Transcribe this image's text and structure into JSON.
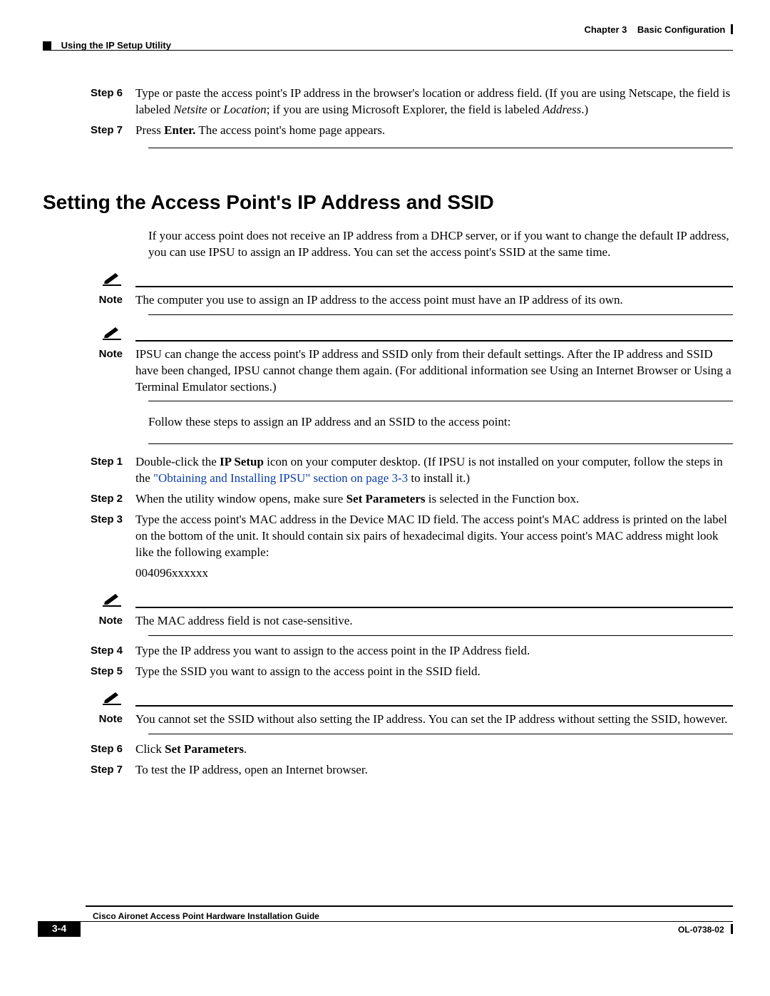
{
  "header": {
    "chapter_label": "Chapter 3",
    "chapter_title": "Basic Configuration",
    "section_title": "Using the IP Setup Utility"
  },
  "top_steps": {
    "s6": {
      "label": "Step 6",
      "t1": "Type or paste the access point's IP address in the browser's location or address field. (If you are using Netscape, the field is labeled ",
      "i1": "Netsite",
      "t2": " or ",
      "i2": "Location",
      "t3": "; if you are using Microsoft Explorer, the field is labeled ",
      "i3": "Address",
      "t4": ".)"
    },
    "s7": {
      "label": "Step 7",
      "t1": "Press ",
      "b1": "Enter.",
      "t2": " The access point's home page appears."
    }
  },
  "heading": "Setting the Access Point's IP Address and SSID",
  "intro": "If your access point does not receive an IP address from a DHCP server, or if you want to change the default IP address, you can use IPSU to assign an IP address. You can set the access point's SSID at the same time.",
  "note1": {
    "label": "Note",
    "text": "The computer you use to assign an IP address to the access point must have an IP address of its own."
  },
  "note2": {
    "label": "Note",
    "t1": "IPSU can change the access point's IP address and SSID only from their default settings. After the IP address and SSID have been changed, IPSU cannot change them again. (For additional information see ",
    "i1": "Using an Internet Browser",
    "t2": " or ",
    "i2": "Using a Terminal Emulator",
    "t3": " sections.)"
  },
  "follow": "Follow these steps to assign an IP address and an SSID to the access point:",
  "steps2": {
    "s1": {
      "label": "Step 1",
      "t1": "Double-click the ",
      "b1": "IP Setup",
      "t2": " icon on your computer desktop. (If IPSU is not installed on your computer, follow the steps in the ",
      "link": "\"Obtaining and Installing IPSU\" section on page 3-3",
      "t3": " to install it.)"
    },
    "s2": {
      "label": "Step 2",
      "t1": "When the utility window opens, make sure ",
      "b1": "Set Parameters",
      "t2": " is selected in the Function box."
    },
    "s3": {
      "label": "Step 3",
      "t1": "Type the access point's MAC address in the Device MAC ID field. The access point's MAC address is printed on the label on the bottom of the unit. It should contain six pairs of hexadecimal digits. Your access point's MAC address might look like the following example:",
      "mac": "004096xxxxxx"
    }
  },
  "note3": {
    "label": "Note",
    "text": "The MAC address field is not case-sensitive."
  },
  "steps3": {
    "s4": {
      "label": "Step 4",
      "t1": "Type the IP address you want to assign to the access point in the IP Address field."
    },
    "s5": {
      "label": "Step 5",
      "t1": "Type the SSID you want to assign to the access point in the SSID field."
    }
  },
  "note4": {
    "label": "Note",
    "text": "You cannot set the SSID without also setting the IP address. You can set the IP address without setting the SSID, however."
  },
  "steps4": {
    "s6": {
      "label": "Step 6",
      "t1": "Click ",
      "b1": "Set Parameters",
      "t2": "."
    },
    "s7": {
      "label": "Step 7",
      "t1": "To test the IP address, open an Internet browser."
    }
  },
  "footer": {
    "guide": "Cisco Aironet Access Point Hardware Installation Guide",
    "page": "3-4",
    "docnum": "OL-0738-02"
  }
}
